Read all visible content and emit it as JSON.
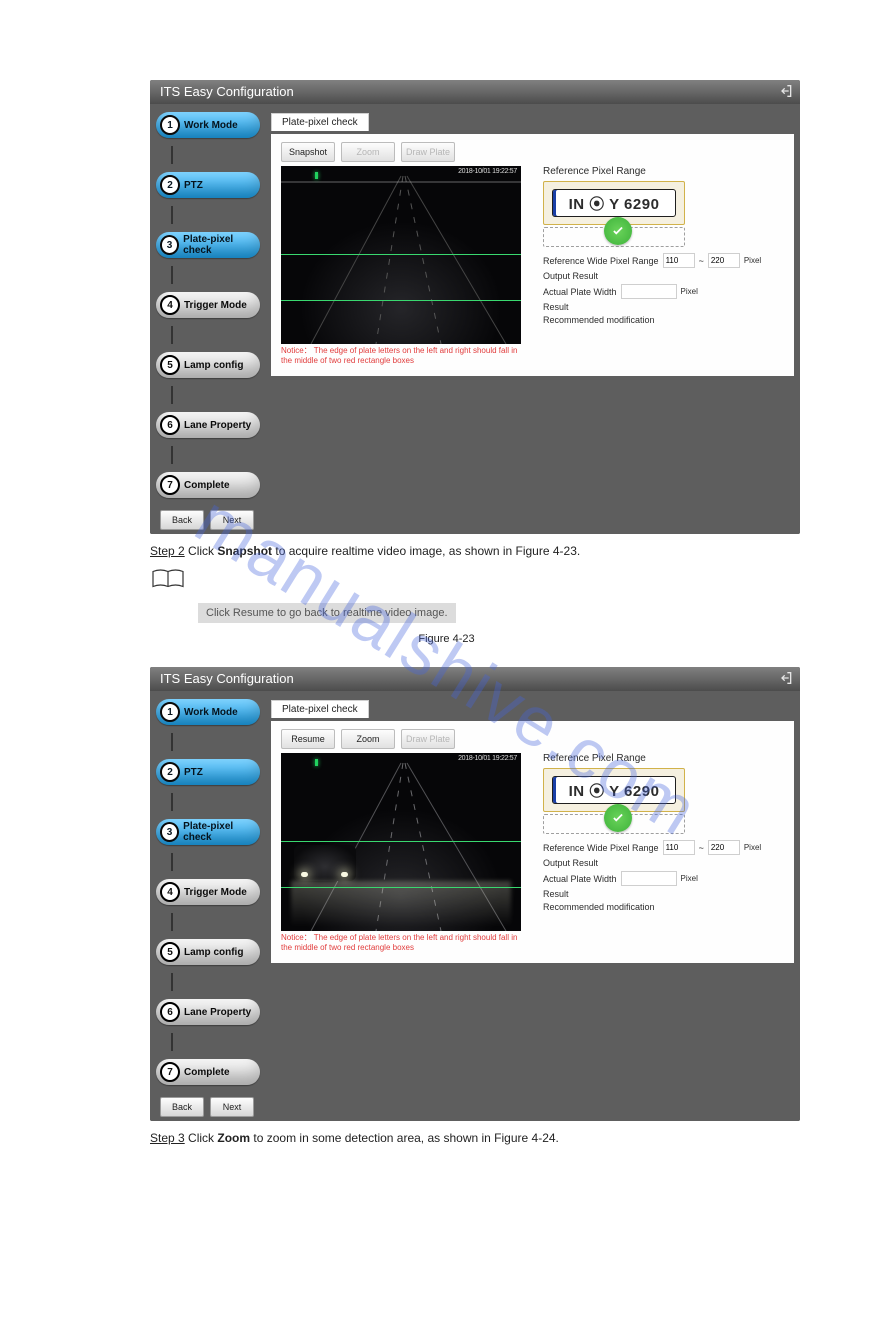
{
  "watermark": "manualshive.com",
  "common": {
    "app_title": "ITS Easy Configuration",
    "tab_label": "Plate-pixel check",
    "steps": [
      {
        "num": "1",
        "label": "Work Mode"
      },
      {
        "num": "2",
        "label": "PTZ"
      },
      {
        "num": "3",
        "label": "Plate-pixel check"
      },
      {
        "num": "4",
        "label": "Trigger Mode"
      },
      {
        "num": "5",
        "label": "Lamp config"
      },
      {
        "num": "6",
        "label": "Lane Property"
      },
      {
        "num": "7",
        "label": "Complete"
      }
    ],
    "notice": "Notice： The edge of plate letters on the left and right should fall in the middle of two red rectangle boxes",
    "form": {
      "ref_range_label": "Reference Pixel Range",
      "ref_wide_label": "Reference Wide Pixel Range",
      "ref_wide_min": "110",
      "ref_wide_sep": "~",
      "ref_wide_max": "220",
      "ref_wide_unit": "Pixel",
      "output_label": "Output Result",
      "actual_label": "Actual Plate Width",
      "actual_value": "",
      "actual_unit": "Pixel",
      "result_label": "Result",
      "recommend_label": "Recommended modification",
      "plate_text": "IN ⦿ Y 6290"
    },
    "back": "Back",
    "next": "Next"
  },
  "shot1": {
    "btn_snapshot": "Snapshot",
    "btn_zoom": "Zoom",
    "btn_drawplate": "Draw Plate",
    "timestamp": "2018-10/01 19:22:57"
  },
  "step2_text": {
    "prefix": "Step 2",
    "body": " Click ",
    "bold": "Snapshot",
    "tail": " to acquire realtime video image, as shown in Figure 4-23."
  },
  "note_box": "Click Resume to go back to realtime video image.",
  "figure23_label": "Figure 4-23",
  "shot2": {
    "btn_resume": "Resume",
    "btn_zoom": "Zoom",
    "btn_drawplate": "Draw Plate",
    "timestamp": "2018-10/01 19:22:57"
  },
  "step3_text": {
    "prefix": "Step 3",
    "body": " Click ",
    "bold": "Zoom",
    "tail": " to zoom in some detection area, as shown in Figure 4-24."
  }
}
